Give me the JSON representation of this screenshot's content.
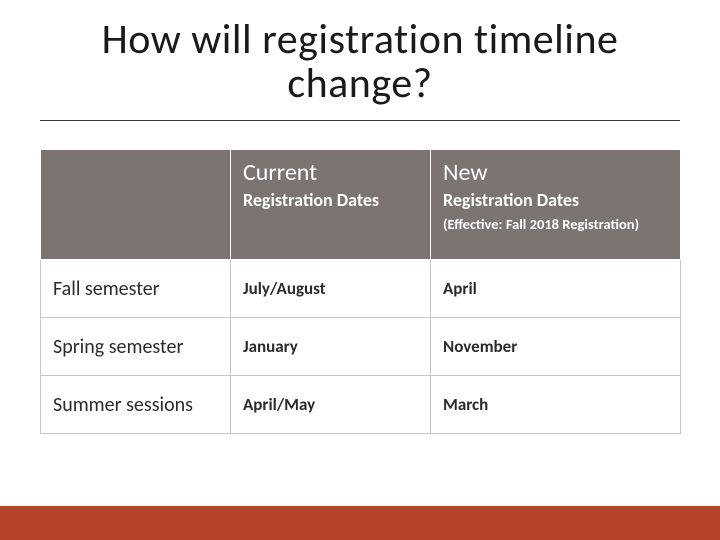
{
  "title": "How will registration timeline change?",
  "chart_data": {
    "type": "table",
    "title": "How will registration timeline change?",
    "columns": [
      "",
      "Current Registration Dates",
      "New Registration Dates (Effective: Fall 2018 Registration)"
    ],
    "rows": [
      [
        "Fall semester",
        "July/August",
        "April"
      ],
      [
        "Spring semester",
        "January",
        "November"
      ],
      [
        "Summer sessions",
        "April/May",
        "March"
      ]
    ]
  },
  "header": {
    "col2_main": "Current",
    "col2_sub": "Registration Dates",
    "col3_main": "New",
    "col3_sub": "Registration Dates",
    "col3_note": "(Effective: Fall 2018 Registration)"
  },
  "rows": [
    {
      "label": "Fall semester",
      "current": "July/August",
      "new": "April"
    },
    {
      "label": "Spring semester",
      "current": "January",
      "new": "November"
    },
    {
      "label": "Summer sessions",
      "current": "April/May",
      "new": "March"
    }
  ],
  "colors": {
    "header_bg": "#7b7470",
    "footer_bg": "#b64428"
  }
}
